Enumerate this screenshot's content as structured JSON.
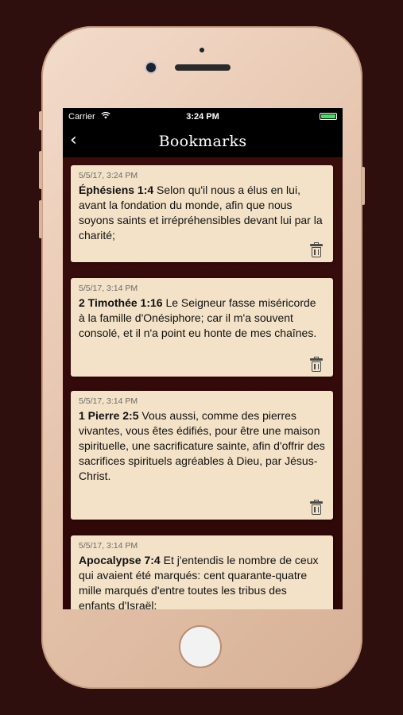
{
  "status": {
    "carrier": "Carrier",
    "time": "3:24 PM"
  },
  "nav": {
    "title": "Bookmarks",
    "back_glyph": "‹"
  },
  "bookmarks": [
    {
      "timestamp": "5/5/17, 3:24 PM",
      "reference": "Éphésiens 1:4",
      "text": " Selon qu'il nous a élus en lui, avant la fondation du monde, afin que nous soyons saints et irrépréhensibles devant lui par la charité;"
    },
    {
      "timestamp": "5/5/17, 3:14 PM",
      "reference": "2 Timothée 1:16",
      "text": " Le Seigneur fasse miséricorde à la famille d'Onésiphore; car il m'a souvent consolé, et il n'a point eu honte de mes chaînes."
    },
    {
      "timestamp": "5/5/17, 3:14 PM",
      "reference": "1 Pierre 2:5",
      "text": " Vous aussi, comme des pierres vivantes, vous êtes édifiés, pour être une maison spirituelle, une sacrificature sainte, afin d'offrir des sacrifices spirituels agréables à Dieu, par Jésus-Christ."
    },
    {
      "timestamp": "5/5/17, 3:14 PM",
      "reference": "Apocalypse 7:4",
      "text": " Et j'entendis le nombre de ceux qui avaient été marqués: cent quarante-quatre mille marqués d'entre toutes les tribus des enfants d'Israël:"
    }
  ],
  "icons": {
    "trash": "trash-icon",
    "wifi": "wifi-icon",
    "battery": "battery-icon",
    "back": "chevron-left-icon"
  },
  "colors": {
    "background": "#2f0e0e",
    "card": "#f3e2c7",
    "battery": "#4cd964"
  }
}
